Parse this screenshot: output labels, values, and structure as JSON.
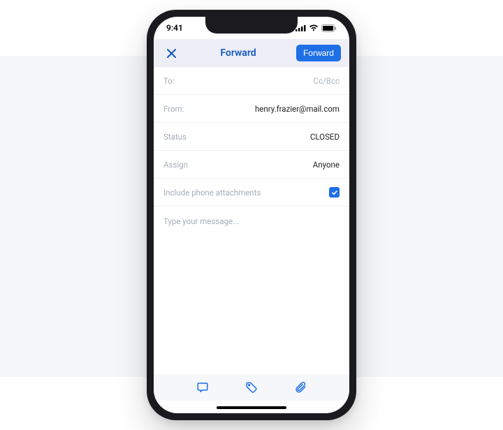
{
  "statusbar": {
    "time": "9:41"
  },
  "navbar": {
    "title": "Forward",
    "action_label": "Forward"
  },
  "fields": {
    "to": {
      "label": "To:",
      "ccbcc": "Cc/Bcc"
    },
    "from": {
      "label": "From:",
      "value": "henry.frazier@mail.com"
    },
    "status": {
      "label": "Status",
      "value": "CLOSED"
    },
    "assign": {
      "label": "Assign",
      "value": "Anyone"
    },
    "include": {
      "label": "Include phone attachments",
      "checked": true
    }
  },
  "message": {
    "placeholder": "Type your message..."
  }
}
